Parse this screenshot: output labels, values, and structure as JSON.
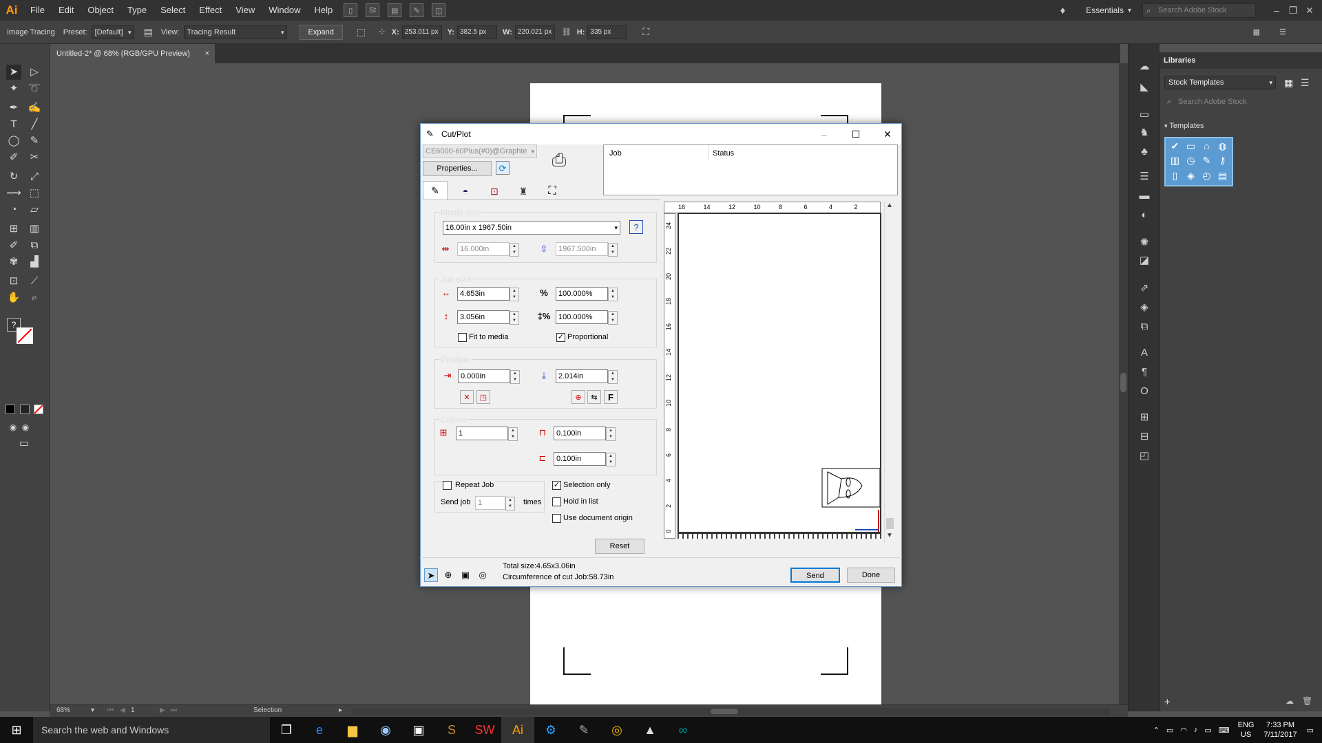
{
  "app": {
    "logo": "Ai",
    "menu": [
      "File",
      "Edit",
      "Object",
      "Type",
      "Select",
      "Effect",
      "View",
      "Window",
      "Help"
    ],
    "workspace": "Essentials",
    "search_placeholder": "Search Adobe Stock"
  },
  "control_bar": {
    "panel_label": "Image Tracing",
    "preset_label": "Preset:",
    "preset_value": "[Default]",
    "view_label": "View:",
    "view_value": "Tracing Result",
    "expand_label": "Expand",
    "x_label": "X:",
    "x_value": "253.011 px",
    "y_label": "Y:",
    "y_value": "382.5 px",
    "w_label": "W:",
    "w_value": "220.021 px",
    "h_label": "H:",
    "h_value": "335 px"
  },
  "document": {
    "tab_title": "Untitled-2* @ 68% (RGB/GPU Preview)",
    "close": "×"
  },
  "status_bar": {
    "zoom": "68%",
    "artboard": "1",
    "tool": "Selection"
  },
  "libraries": {
    "title": "Libraries",
    "selected_library": "Stock Templates",
    "search_placeholder": "Search Adobe Stock",
    "section": "Templates"
  },
  "dialog": {
    "title": "Cut/Plot",
    "device": "CE6000-60Plus(#0)@Graphte",
    "properties_label": "Properties...",
    "job_columns": [
      "Job",
      "Status"
    ],
    "media_size": {
      "title": "Media size",
      "selected": "16.00in x 1967.50in",
      "width": "16.000in",
      "length": "1967.500in"
    },
    "job_size": {
      "title": "Job size",
      "width": "4.653in",
      "height": "3.056in",
      "scale_x": "100.000%",
      "scale_y": "100.000%",
      "fit_to_media": "Fit to media",
      "proportional": "Proportional"
    },
    "position": {
      "title": "Position",
      "x": "0.000in",
      "y": "2.014in"
    },
    "copies": {
      "title": "Copies",
      "count": "1",
      "spacing_x": "0.100in",
      "spacing_y": "0.100in"
    },
    "repeat_job": "Repeat Job",
    "send_job_label": "Send job",
    "send_job_count": "1",
    "times_label": "times",
    "selection_only": "Selection only",
    "hold_in_list": "Hold in list",
    "use_document_origin": "Use document origin",
    "reset_label": "Reset",
    "total_size": "Total size:4.65x3.06in",
    "circumference": "Circumference of cut Job:58.73in",
    "send_label": "Send",
    "done_label": "Done",
    "ruler_top": [
      "16",
      "14",
      "12",
      "10",
      "8",
      "6",
      "4",
      "2"
    ],
    "ruler_left": [
      "24",
      "22",
      "20",
      "18",
      "16",
      "14",
      "12",
      "10",
      "8",
      "6",
      "4",
      "2",
      "0"
    ]
  },
  "taskbar": {
    "search_placeholder": "Search the web and Windows",
    "lang": "ENG",
    "region": "US",
    "time": "7:33 PM",
    "date": "7/11/2017"
  }
}
